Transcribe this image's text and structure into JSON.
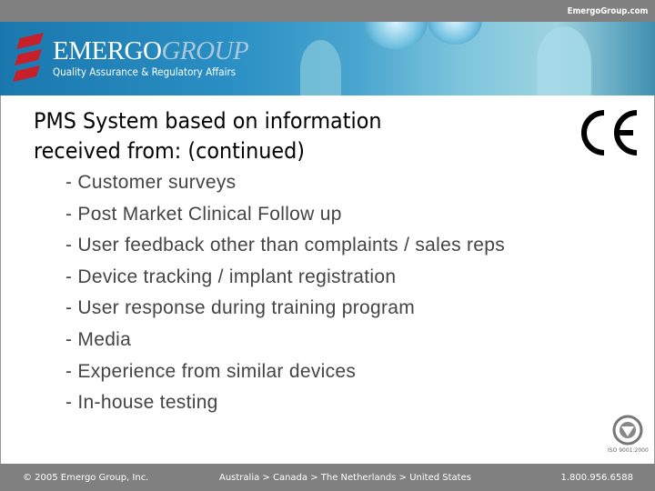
{
  "header": {
    "site": "EmergoGroup.com",
    "brand_primary": "EMERGO",
    "brand_secondary": "GROUP",
    "tagline": "Quality Assurance & Regulatory Affairs"
  },
  "slide": {
    "title_line1": "PMS System based on information",
    "title_line2": "received from: (continued)",
    "ce_mark": "CE",
    "bullets": [
      "- Customer surveys",
      "- Post Market Clinical Follow up",
      "- User feedback other than complaints / sales reps",
      "- Device tracking / implant registration",
      "- User response during training program",
      "- Media",
      "- Experience from similar devices",
      "- In-house testing"
    ],
    "iso_badge": "ISO 9001:2000"
  },
  "footer": {
    "copyright": "© 2005 Emergo Group, Inc.",
    "locations": "Australia > Canada > The Netherlands > United States",
    "phone": "1.800.956.6588"
  },
  "colors": {
    "topbar": "#808080",
    "banner": "#1a78ad",
    "logo_red": "#c8202a",
    "bullet_text": "#444444"
  }
}
